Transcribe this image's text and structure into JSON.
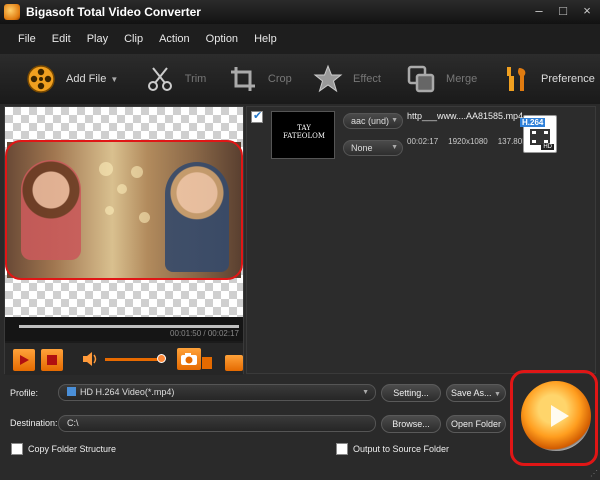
{
  "window": {
    "title": "Bigasoft Total Video Converter"
  },
  "menu": [
    "File",
    "Edit",
    "Play",
    "Clip",
    "Action",
    "Option",
    "Help"
  ],
  "toolbar": {
    "add_file": "Add File",
    "trim": "Trim",
    "crop": "Crop",
    "effect": "Effect",
    "merge": "Merge",
    "preference": "Preference"
  },
  "preview": {
    "time_readout": "00:01:50 / 00:02:17"
  },
  "file": {
    "checked": true,
    "thumb_text": "TAY FATEOLOM",
    "audio_track": "aac (und)",
    "subtitle": "None",
    "name": "http___www....AA81585.mp4",
    "duration": "00:02:17",
    "resolution": "1920x1080",
    "size": "137.80MB",
    "badge": "H.264",
    "badge_hd": "HD"
  },
  "settings": {
    "profile_label": "Profile:",
    "profile_value": "HD H.264 Video(*.mp4)",
    "setting_btn": "Setting...",
    "save_as_btn": "Save As...",
    "destination_label": "Destination:",
    "destination_value": "C:\\",
    "browse_btn": "Browse...",
    "open_folder_btn": "Open Folder",
    "copy_folder": "Copy Folder Structure",
    "output_source": "Output to Source Folder"
  },
  "colors": {
    "accent": "#e56a00",
    "highlight": "#e01616"
  }
}
